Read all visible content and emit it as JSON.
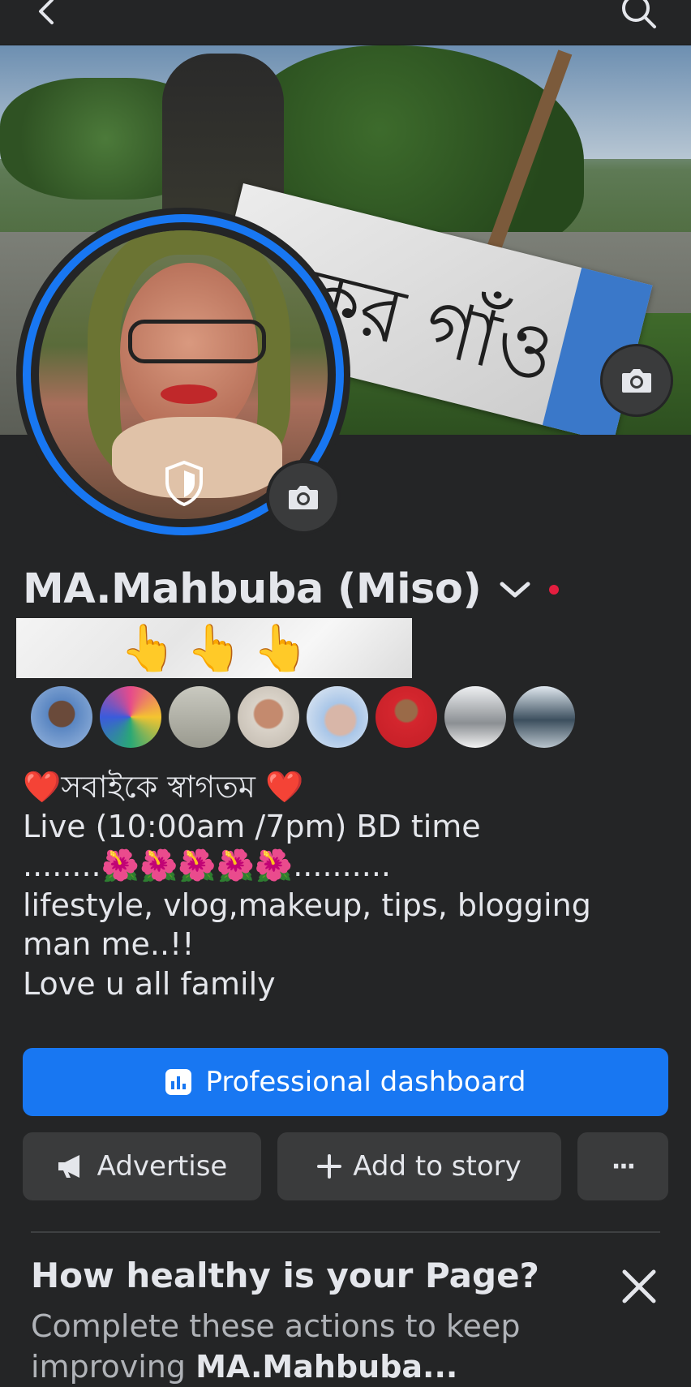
{
  "profile": {
    "name": "MA.Mahbuba (Miso)",
    "fingers": "👆👆👆"
  },
  "cover": {
    "sign_text": "ফকর গাঁও"
  },
  "bio": {
    "line1": "❤️সবাইকে স্বাগতম ❤️",
    "line2": " Live (10:00am /7pm) BD time",
    "line3": "........🌺🌺🌺🌺🌺..........",
    "line4": "lifestyle, vlog,makeup, tips, blogging",
    "line5": "man me..!!",
    "line6": "Love u all family"
  },
  "buttons": {
    "dashboard": "Professional dashboard",
    "advertise": "Advertise",
    "add_story": "Add to story",
    "more": "···"
  },
  "health": {
    "title": "How healthy is your Page?",
    "subtitle_prefix": "Complete these actions to keep improving ",
    "subtitle_name": "MA.Mahbuba..."
  },
  "colors": {
    "background": "#242526",
    "accent": "#1877f2",
    "secondary_button": "#3a3b3c",
    "notification_dot": "#e41e3f"
  },
  "icons": [
    "back-arrow-icon",
    "search-icon",
    "camera-icon",
    "shield-icon",
    "chevron-down-icon",
    "dashboard-chart-icon",
    "megaphone-icon",
    "plus-icon",
    "more-icon",
    "close-icon"
  ]
}
